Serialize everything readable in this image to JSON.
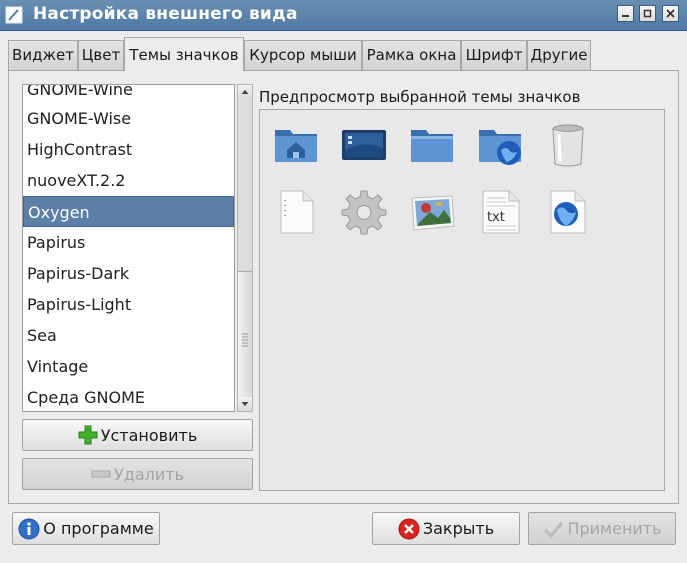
{
  "window": {
    "title": "Настройка внешнего вида",
    "controls": [
      "minimize",
      "maximize",
      "close"
    ]
  },
  "tabs": [
    {
      "label": "Виджет",
      "active": false
    },
    {
      "label": "Цвет",
      "active": false
    },
    {
      "label": "Темы значков",
      "active": true
    },
    {
      "label": "Курсор мыши",
      "active": false
    },
    {
      "label": "Рамка окна",
      "active": false
    },
    {
      "label": "Шрифт",
      "active": false
    },
    {
      "label": "Другие",
      "active": false
    }
  ],
  "theme_list": {
    "items": [
      "GNOME-Wine",
      "GNOME-Wise",
      "HighContrast",
      "nuoveXT.2.2",
      "Oxygen",
      "Papirus",
      "Papirus-Dark",
      "Papirus-Light",
      "Sea",
      "Vintage",
      "Среда GNOME"
    ],
    "selected": "Oxygen"
  },
  "list_buttons": {
    "install_label": "Установить",
    "remove_label": "Удалить"
  },
  "preview": {
    "label": "Предпросмотр выбранной темы значков",
    "icons": [
      "user-home-folder-icon",
      "desktop-icon",
      "folder-icon",
      "remote-folder-icon",
      "trash-icon",
      "text-file-icon",
      "settings-gear-icon",
      "image-file-icon",
      "txt-file-icon",
      "html-file-icon"
    ],
    "txt_text": "txt"
  },
  "bottom_buttons": {
    "about_label": "О программе",
    "close_label": "Закрыть",
    "apply_label": "Применить"
  },
  "colors": {
    "titlebar": "#5b83ab",
    "selection": "#5b7fa6",
    "install_icon": "#3fae2c",
    "close_icon": "#d8231f"
  }
}
